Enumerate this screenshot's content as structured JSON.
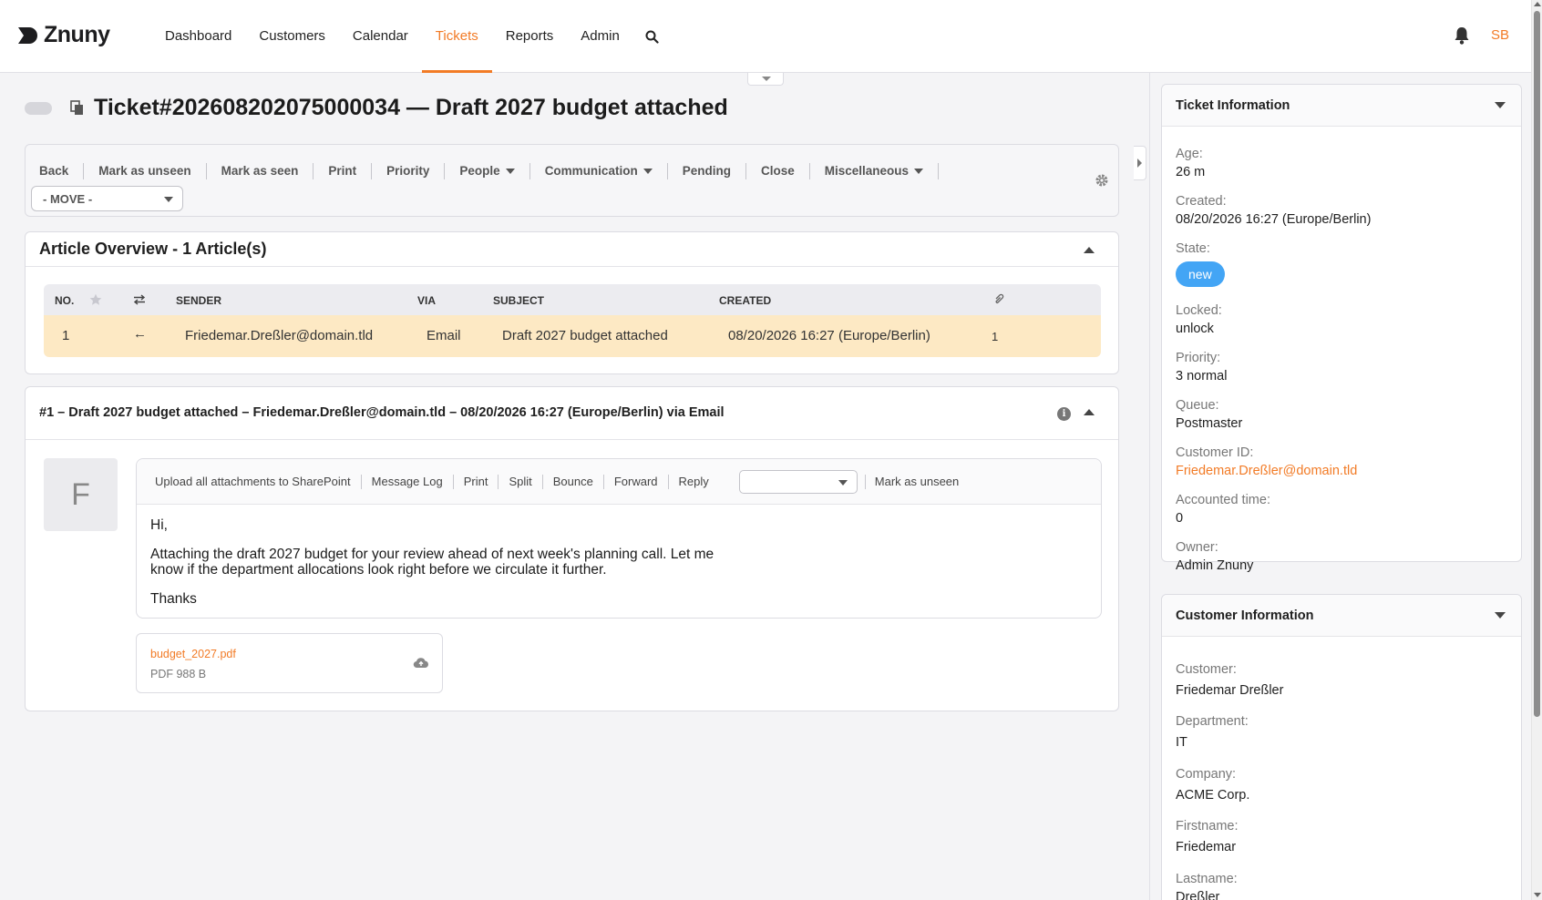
{
  "brand": {
    "name": "Znuny",
    "accent": "#f27b26"
  },
  "nav": {
    "items": [
      "Dashboard",
      "Customers",
      "Calendar",
      "Tickets",
      "Reports",
      "Admin"
    ],
    "active": "Tickets",
    "search_icon": "search-icon"
  },
  "user": {
    "initials": "SB",
    "bell_icon": "bell-icon"
  },
  "ticket": {
    "title": "Ticket#202608202075000034 — Draft 2027 budget attached"
  },
  "actions": {
    "items": [
      "Back",
      "Mark as unseen",
      "Mark as seen",
      "Print",
      "Priority",
      "People",
      "Communication",
      "Pending",
      "Close",
      "Miscellaneous"
    ],
    "move_label": "- MOVE -"
  },
  "overview": {
    "title": "Article Overview - 1 Article(s)",
    "headers": {
      "no": "NO.",
      "sender": "SENDER",
      "via": "VIA",
      "subject": "SUBJECT",
      "created": "CREATED"
    },
    "rows": [
      {
        "no": "1",
        "direction": "←",
        "sender": "Friedemar.Dreßler@domain.tld",
        "via": "Email",
        "subject": "Draft 2027 budget attached",
        "created": "08/20/2026 16:27 (Europe/Berlin)",
        "attachments": "1"
      }
    ]
  },
  "article": {
    "header": "#1 – Draft 2027 budget attached – Friedemar.Dreßler@domain.tld – 08/20/2026 16:27 (Europe/Berlin) via Email",
    "avatar_letter": "F",
    "toolbar": [
      "Upload all attachments to SharePoint",
      "Message Log",
      "Print",
      "Split",
      "Bounce",
      "Forward",
      "Reply"
    ],
    "toolbar_last": "Mark as unseen",
    "body": {
      "greeting": "Hi,",
      "line1": "Attaching the draft 2027 budget for your review ahead of next week's planning call. Let me",
      "line2": "know if the department allocations look right before we circulate it further.",
      "closing": "Thanks"
    },
    "attachment": {
      "name": "budget_2027.pdf",
      "meta": "PDF 988 B"
    }
  },
  "ticket_info": {
    "title": "Ticket Information",
    "fields": [
      {
        "label": "Age:",
        "value": "26 m"
      },
      {
        "label": "Created:",
        "value": "08/20/2026 16:27 (Europe/Berlin)"
      },
      {
        "label": "State:",
        "value": "new"
      },
      {
        "label": "Locked:",
        "value": "unlock"
      },
      {
        "label": "Priority:",
        "value": "3 normal"
      },
      {
        "label": "Queue:",
        "value": "Postmaster"
      },
      {
        "label": "Customer ID:",
        "value": "Friedemar.Dreßler@domain.tld"
      },
      {
        "label": "Accounted time:",
        "value": "0"
      },
      {
        "label": "Owner:",
        "value": "Admin Znuny"
      }
    ],
    "state_color": "#43a5f5"
  },
  "customer_info": {
    "title": "Customer Information",
    "fields": [
      {
        "label": "Customer:",
        "value": "Friedemar Dreßler"
      },
      {
        "label": "Department:",
        "value": "IT"
      },
      {
        "label": "Company:",
        "value": "ACME Corp."
      },
      {
        "label": "Firstname:",
        "value": "Friedemar"
      },
      {
        "label": "Lastname:",
        "value": "Dreßler"
      }
    ]
  }
}
